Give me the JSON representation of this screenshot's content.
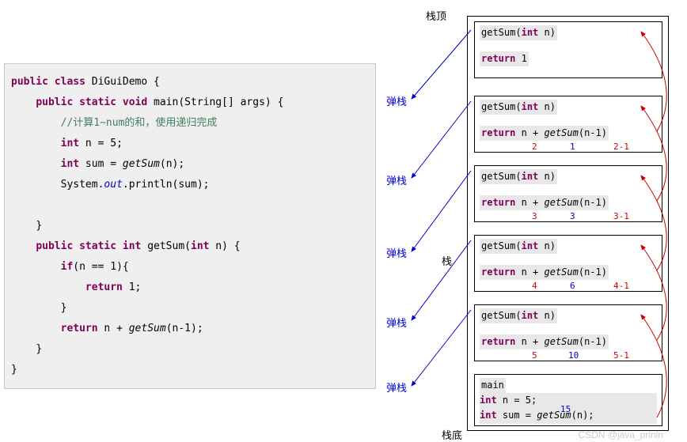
{
  "code": {
    "l1_kw1": "public class",
    "l1_cls": " DiGuiDemo {",
    "l2_kw": "public static void",
    "l2_m": " main(String[] args) {",
    "l3_comment": "//计算1~num的和，使用递归完成",
    "l4_kw": "int",
    "l4_rest": " n = 5;",
    "l5_kw": "int",
    "l5_rest": " sum = ",
    "l5_fn": "getSum",
    "l5_arg": "(n);",
    "l6_sys": "System.",
    "l6_out": "out",
    "l6_rest": ".println(sum);",
    "l7": "}",
    "l8_kw": "public static int",
    "l8_m": " getSum(",
    "l8_p": "int",
    "l8_pr": " n) {",
    "l9_kw": "if",
    "l9_rest": "(n == 1){",
    "l10_kw": "return",
    "l10_rest": " 1;",
    "l11": "}",
    "l12_kw": "return",
    "l12_rest": " n + ",
    "l12_fn": "getSum",
    "l12_arg": "(n-1);",
    "l13": "}",
    "l14": "}"
  },
  "labels": {
    "top": "栈顶",
    "stack": "栈",
    "bottom": "栈底",
    "pop": "弹栈",
    "watermark": "CSDN @java_prinln"
  },
  "frames": {
    "sig_fn": "getSum",
    "sig_type": "int",
    "sig_param": " n",
    "ret_kw": "return",
    "ret1": " 1",
    "ret_expr": " n + ",
    "ret_fn": "getSum",
    "ret_arg": "(n-1)",
    "main_label": "main",
    "main_l1_kw": "int",
    "main_l1": " n = 5;",
    "main_l2_kw": "int",
    "main_l2": " sum = ",
    "main_l2_fn": "getSum",
    "main_l2_arg": "(n);",
    "f2_n": "2",
    "f2_ret": "1",
    "f2_calc": "2-1",
    "f3_n": "3",
    "f3_ret": "3",
    "f3_calc": "3-1",
    "f4_n": "4",
    "f4_ret": "6",
    "f4_calc": "4-1",
    "f5_n": "5",
    "f5_ret": "10",
    "f5_calc": "5-1",
    "main_ret": "15"
  }
}
